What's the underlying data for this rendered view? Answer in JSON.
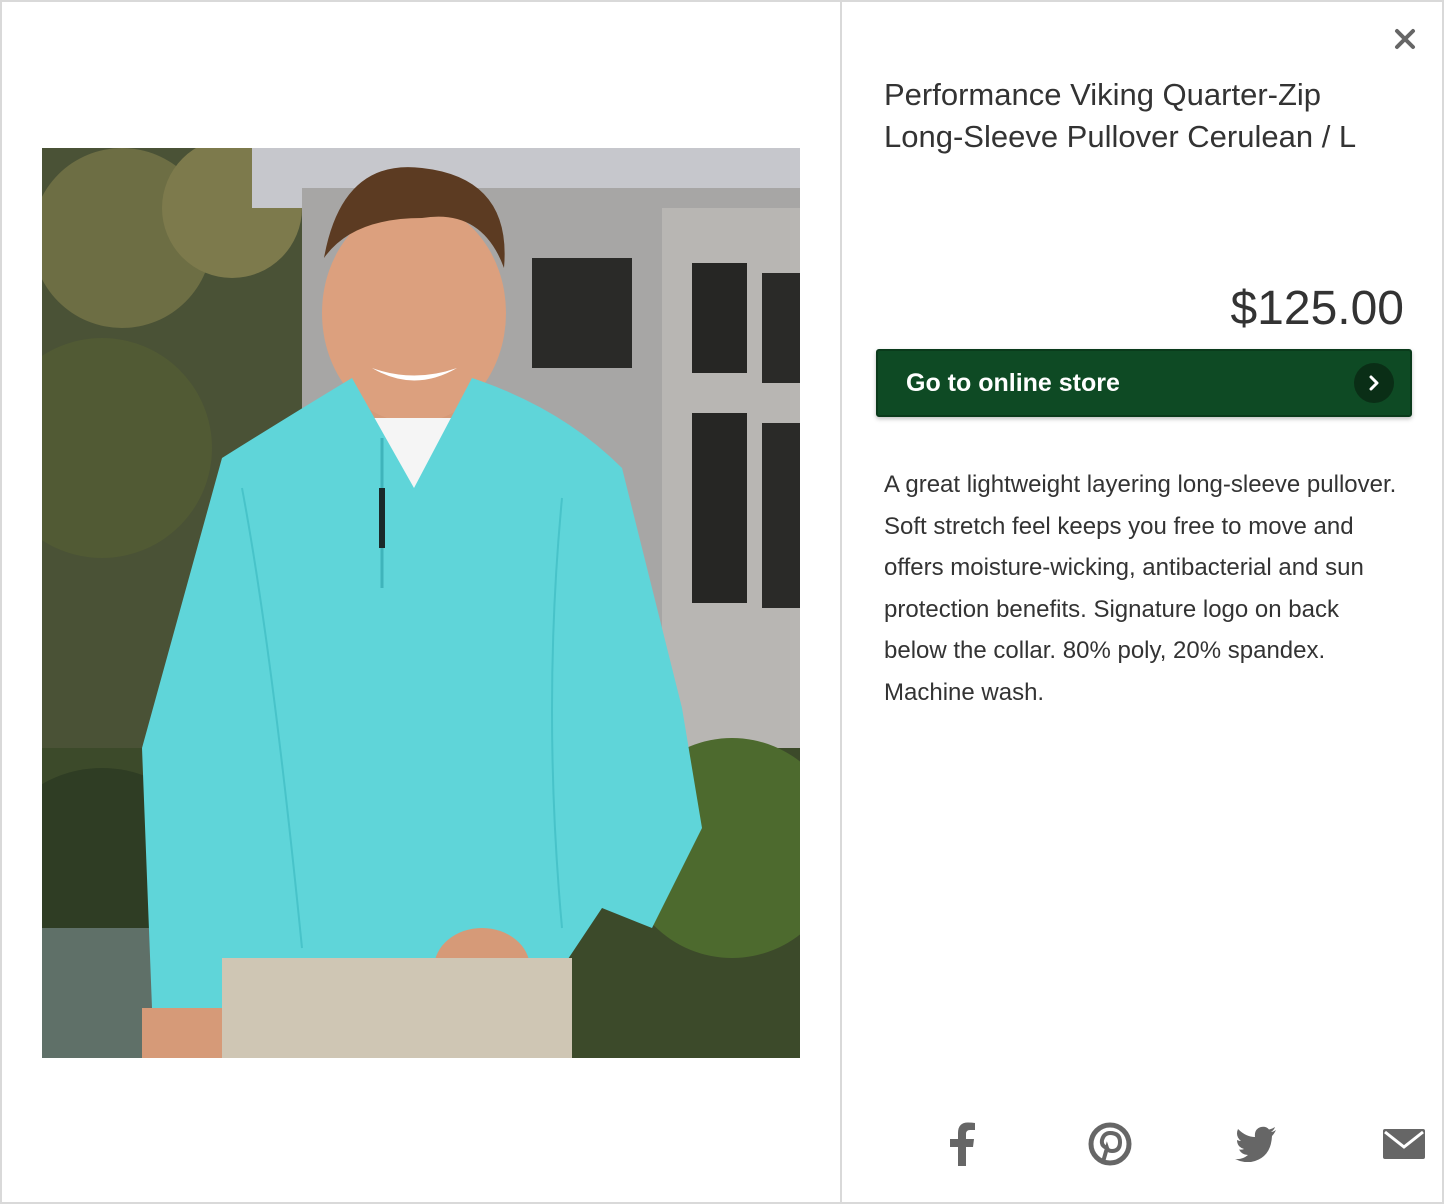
{
  "product": {
    "title": "Performance Viking Quarter-Zip Long-Sleeve Pullover Cerulean / L",
    "price": "$125.00",
    "description": "A great lightweight layering long-sleeve pullover. Soft stretch feel keeps you free to move and offers moisture-wicking, antibacterial and sun protection benefits. Signature logo on back below the collar. 80% poly, 20% spandex. Machine wash."
  },
  "actions": {
    "store_button_label": "Go to online store"
  },
  "icons": {
    "close": "close-icon",
    "arrow": "chevron-right-icon",
    "share": [
      "facebook-icon",
      "pinterest-icon",
      "twitter-icon",
      "email-icon"
    ]
  },
  "colors": {
    "button_bg": "#0e4a24",
    "icon_gray": "#666666",
    "text": "#333333",
    "border": "#d9d9d9",
    "shirt": "#5fd5d9"
  }
}
